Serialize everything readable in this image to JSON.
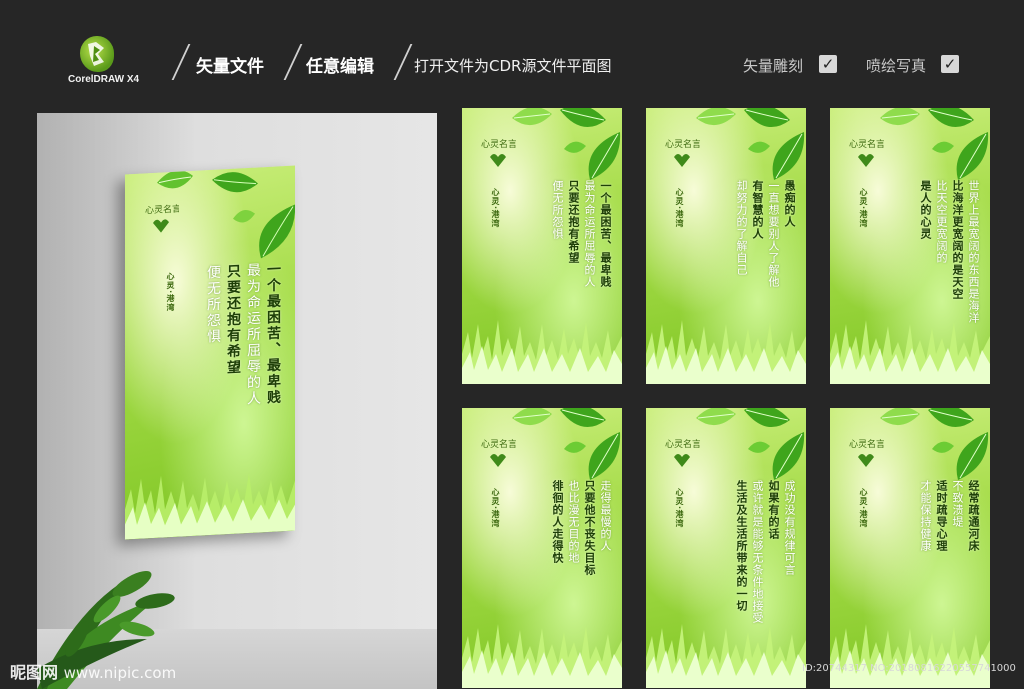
{
  "header": {
    "logo_text": "CorelDRAW X4",
    "item1": "矢量文件",
    "item2": "任意编辑",
    "item3": "打开文件为CDR源文件平面图",
    "check1_label": "矢量雕刻",
    "check2_label": "喷绘写真",
    "check_mark": "✓"
  },
  "poster_brand": "心灵·港湾",
  "poster_logo_text": "心灵名言",
  "posters": [
    {
      "lines": [
        "一个最困苦、最卑贱",
        "最为命运所屈辱的人",
        "只要还抱有希望",
        "便无所怨惧"
      ],
      "bold": [
        0,
        2
      ]
    },
    {
      "lines": [
        "一个最困苦、最卑贱",
        "最为命运所屈辱的人",
        "只要还抱有希望",
        "便无所怨惧"
      ],
      "bold": [
        0,
        2
      ]
    },
    {
      "lines": [
        "愚痴的人",
        "一直想要别人了解他",
        "有智慧的人",
        "却努力的了解自己"
      ],
      "bold": [
        0,
        2
      ]
    },
    {
      "lines": [
        "世界上最宽阔的东西是海洋",
        "比海洋更宽阔的是天空",
        "比天空更宽阔的",
        "是人的心灵"
      ],
      "bold": [
        1,
        3
      ]
    },
    {
      "lines": [
        "走得最慢的人",
        "只要他不丧失目标",
        "也比漫无目的地",
        "徘徊的人走得快"
      ],
      "bold": [
        1,
        3
      ]
    },
    {
      "lines": [
        "成功没有规律可言",
        "如果有的话",
        "或许就是能够无条件地接受",
        "生活及生活所带来的一切"
      ],
      "bold": [
        1,
        3
      ]
    },
    {
      "lines": [
        "经常疏通河床",
        "不致溃堤",
        "适时疏导心理",
        "才能保持健康"
      ],
      "bold": [
        0,
        2
      ]
    }
  ],
  "watermark": {
    "site": "昵图网",
    "url": "www.nipic.com",
    "id": "ID:20744317 NO:20180816220557741000"
  },
  "colors": {
    "background": "#262626",
    "poster_green": "#8fcf33",
    "leaf_green": "#3fa51c",
    "text_dark": "#1e3f07"
  }
}
